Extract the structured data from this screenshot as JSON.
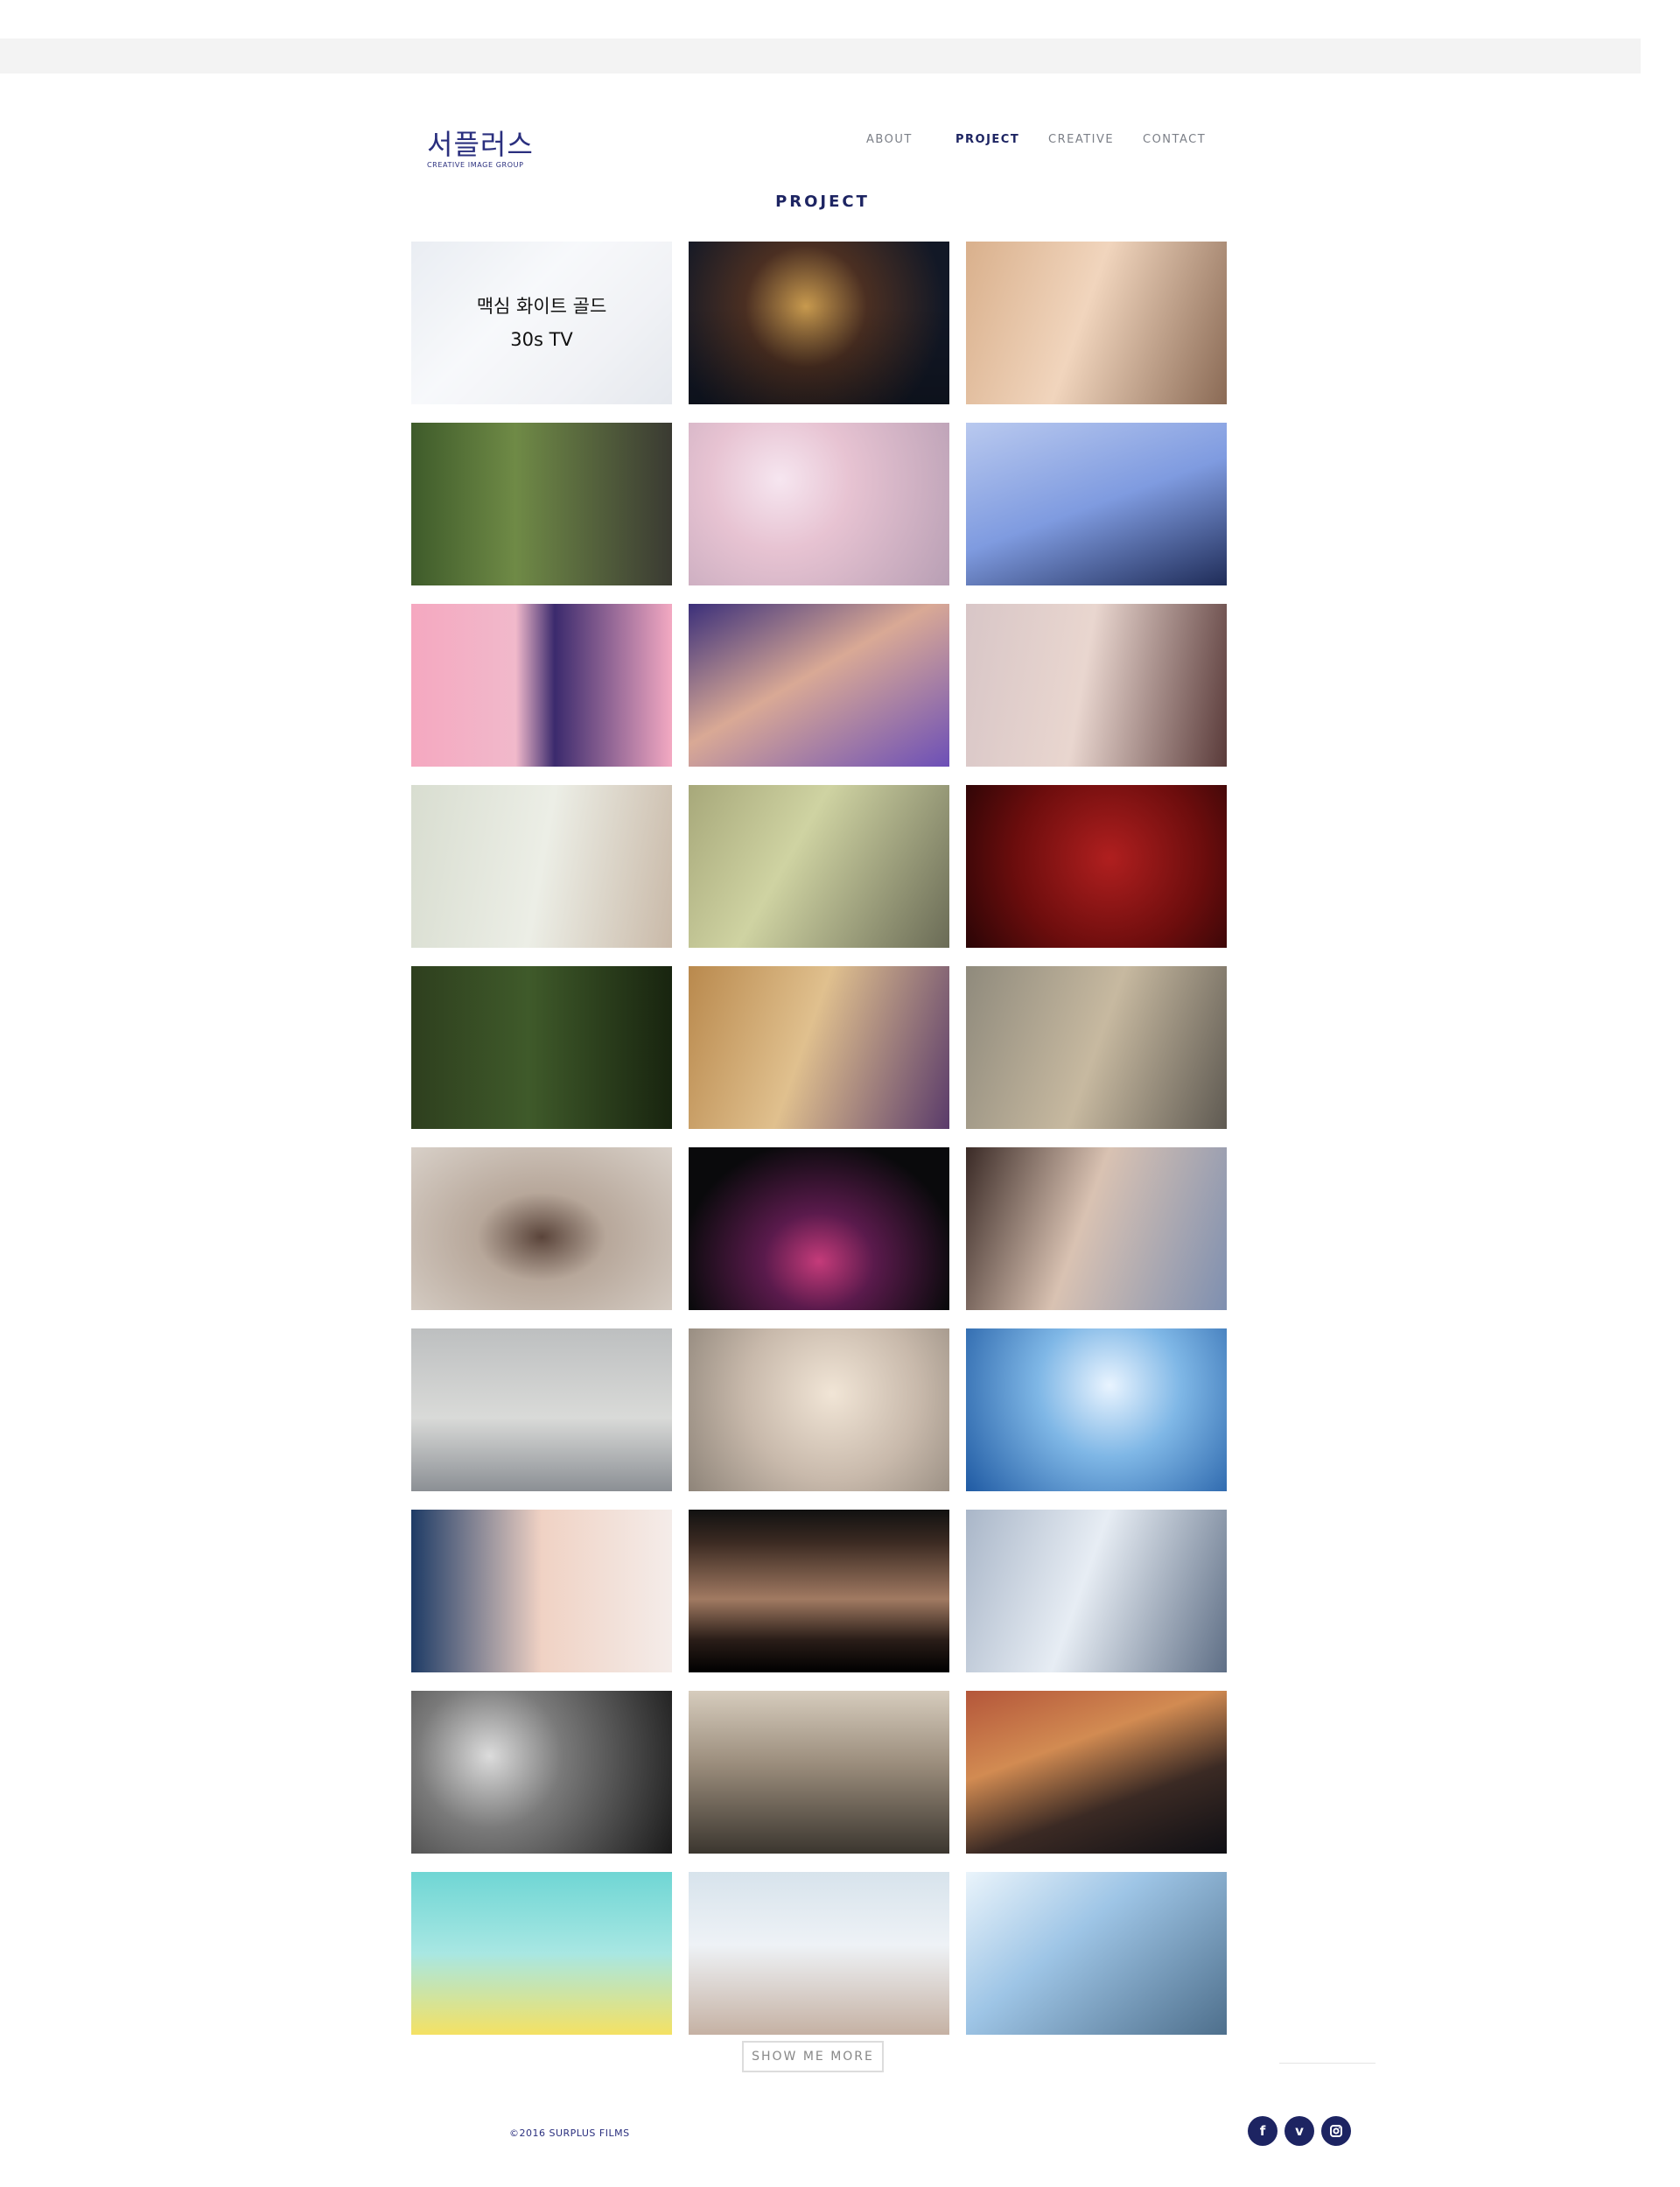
{
  "header": {
    "logo_ko": "서플러스",
    "logo_en": "CREATIVE IMAGE GROUP"
  },
  "nav": {
    "items": [
      "ABOUT",
      "PROJECT",
      "CREATIVE",
      "CONTACT"
    ],
    "active": "PROJECT"
  },
  "page_title": "PROJECT",
  "grid": {
    "featured_line1": "맥심 화이트 골드",
    "featured_line2": "30s TV",
    "tiles": [
      {
        "id": "t1"
      },
      {
        "id": "t2"
      },
      {
        "id": "t3"
      },
      {
        "id": "t4"
      },
      {
        "id": "t5"
      },
      {
        "id": "t6"
      },
      {
        "id": "t7"
      },
      {
        "id": "t8"
      },
      {
        "id": "t9"
      },
      {
        "id": "t10"
      },
      {
        "id": "t11"
      },
      {
        "id": "t12"
      },
      {
        "id": "t13"
      },
      {
        "id": "t14"
      },
      {
        "id": "t15"
      },
      {
        "id": "t16"
      },
      {
        "id": "t17"
      },
      {
        "id": "t18"
      },
      {
        "id": "t19"
      },
      {
        "id": "t20"
      },
      {
        "id": "t21"
      },
      {
        "id": "t22"
      },
      {
        "id": "t23"
      },
      {
        "id": "t24"
      },
      {
        "id": "t25"
      },
      {
        "id": "t26"
      },
      {
        "id": "t27"
      },
      {
        "id": "t28"
      },
      {
        "id": "t29"
      },
      {
        "id": "t30"
      }
    ]
  },
  "buttons": {
    "show_more": "SHOW ME MORE"
  },
  "footer": {
    "copyright": "©2016 SURPLUS FILMS",
    "social": [
      "facebook-icon",
      "vimeo-icon",
      "instagram-icon"
    ]
  },
  "colors": {
    "brand_navy": "#1d2462",
    "nav_gray": "#7b7f87",
    "topbar_gray": "#f3f3f3"
  }
}
